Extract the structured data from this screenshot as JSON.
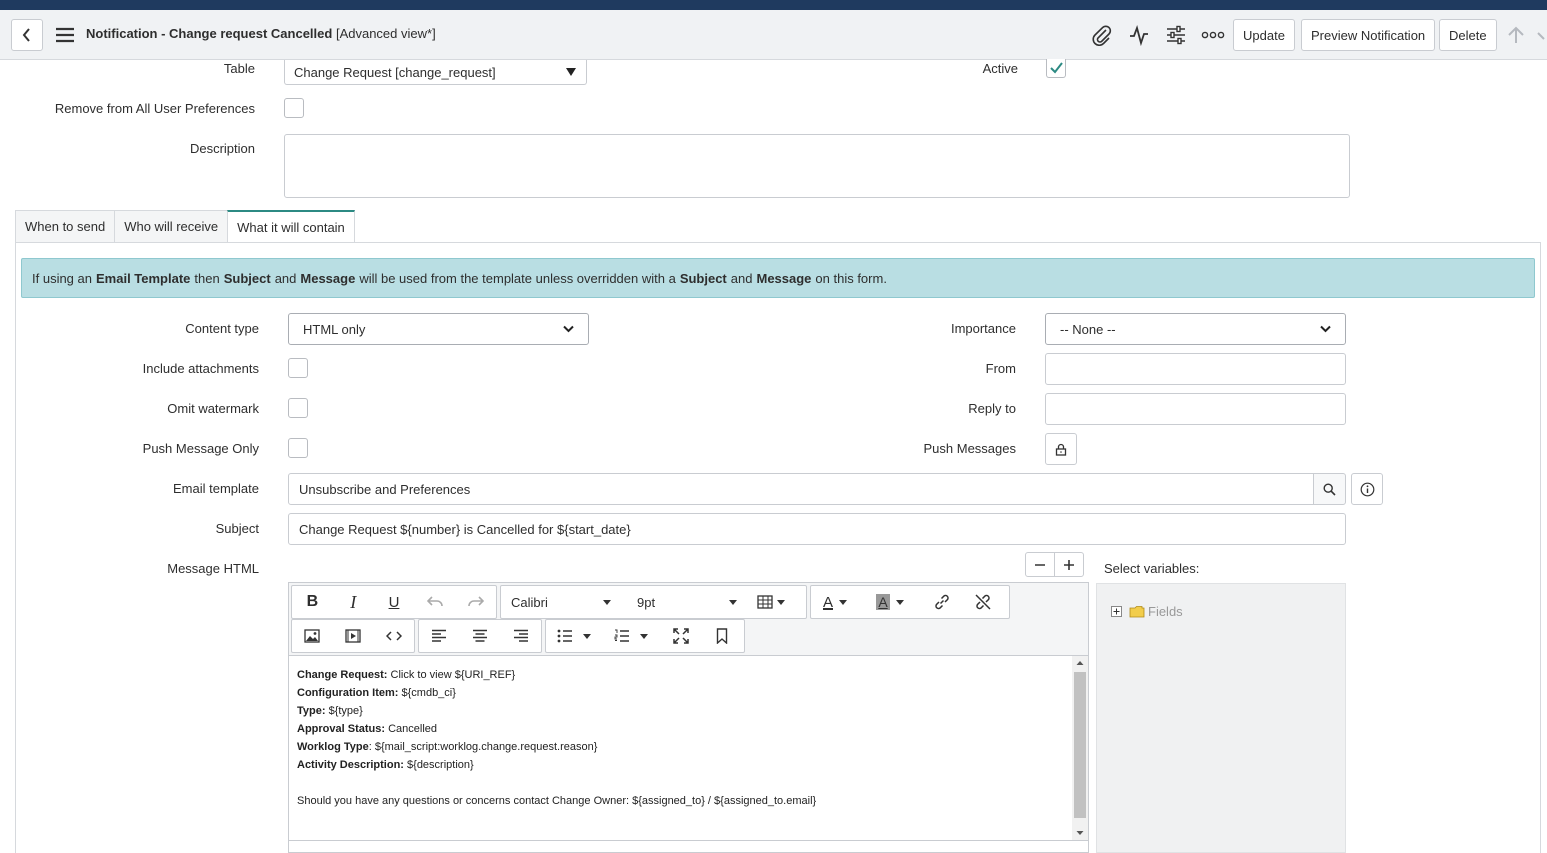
{
  "header": {
    "title_bold": "Notification - Change request Cancelled",
    "title_view": "[Advanced view*]",
    "icons": [
      "paperclip-icon",
      "activity-icon",
      "settings-sliders-icon",
      "more-icon",
      "arrow-up-icon"
    ],
    "buttons": {
      "update": "Update",
      "preview": "Preview Notification",
      "delete": "Delete"
    }
  },
  "top_form": {
    "table_label": "Table",
    "table_value": "Change Request [change_request]",
    "active_label": "Active",
    "active_checked": true,
    "remove_label": "Remove from All User Preferences",
    "description_label": "Description",
    "description_value": ""
  },
  "tabs": [
    "When to send",
    "Who will receive",
    "What it will contain"
  ],
  "active_tab": "What it will contain",
  "info": {
    "p1": "If using an",
    "b1": "Email Template",
    "p2": "then",
    "b2": "Subject",
    "p3": "and",
    "b3": "Message",
    "p4": "will be used from the template unless overridden with a",
    "b4": "Subject",
    "p5": "and",
    "b5": "Message",
    "p6": "on this form."
  },
  "form": {
    "content_type_label": "Content type",
    "content_type_value": "HTML only",
    "importance_label": "Importance",
    "importance_value": "-- None --",
    "include_attachments_label": "Include attachments",
    "from_label": "From",
    "from_value": "",
    "omit_watermark_label": "Omit watermark",
    "reply_to_label": "Reply to",
    "reply_to_value": "",
    "push_only_label": "Push Message Only",
    "push_messages_label": "Push Messages",
    "email_template_label": "Email template",
    "email_template_value": "Unsubscribe and Preferences",
    "subject_label": "Subject",
    "subject_value": "Change Request  ${number} is Cancelled for ${start_date}",
    "message_html_label": "Message HTML",
    "select_variables_label": "Select variables:",
    "fields_label": "Fields"
  },
  "editor": {
    "font": "Calibri",
    "size": "9pt",
    "lines": [
      {
        "bold": "Change Request:",
        "text": " Click to view ${URI_REF}"
      },
      {
        "bold": "Configuration Item:",
        "text": " ${cmdb_ci}"
      },
      {
        "bold": "Type:",
        "text": " ${type}"
      },
      {
        "bold": "Approval Status:",
        "text": " Cancelled"
      },
      {
        "bold": "Worklog Type",
        "text": ": ${mail_script:worklog.change.request.reason}"
      },
      {
        "bold": "Activity Description:",
        "text": " ${description}"
      },
      {
        "bold": "",
        "text": ""
      },
      {
        "bold": "",
        "text": "Should you have any questions or concerns contact  Change Owner: ${assigned_to} / ${assigned_to.email}"
      }
    ]
  }
}
